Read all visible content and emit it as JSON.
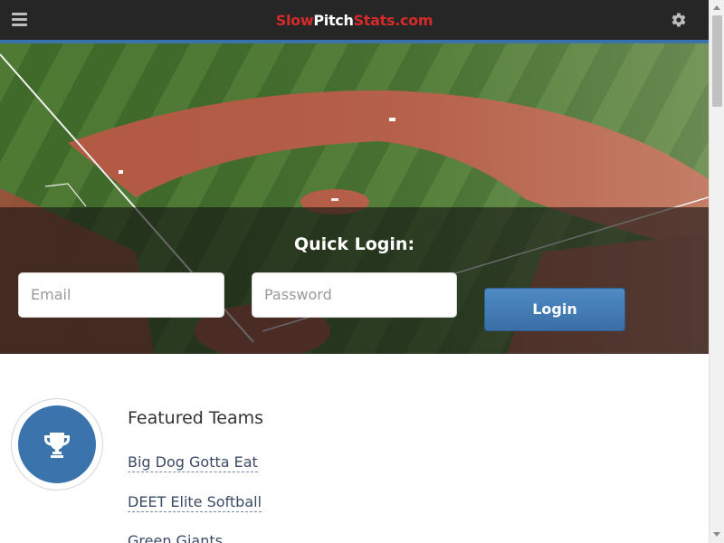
{
  "header": {
    "brand_part1": "Slow",
    "brand_part2": "Pitch",
    "brand_part3": "Stats.com",
    "menu_icon": "hamburger-menu-icon",
    "settings_icon": "gear-icon"
  },
  "login": {
    "title": "Quick Login:",
    "email_placeholder": "Email",
    "password_placeholder": "Password",
    "button_label": "Login"
  },
  "featured": {
    "title": "Featured Teams",
    "icon": "trophy-icon",
    "teams": [
      "Big Dog Gotta Eat",
      "DEET Elite Softball",
      "Green Giants"
    ]
  },
  "colors": {
    "header_bg": "#262626",
    "accent": "#3b74ad",
    "brand_red": "#d42a2a",
    "link": "#3a4a64"
  }
}
